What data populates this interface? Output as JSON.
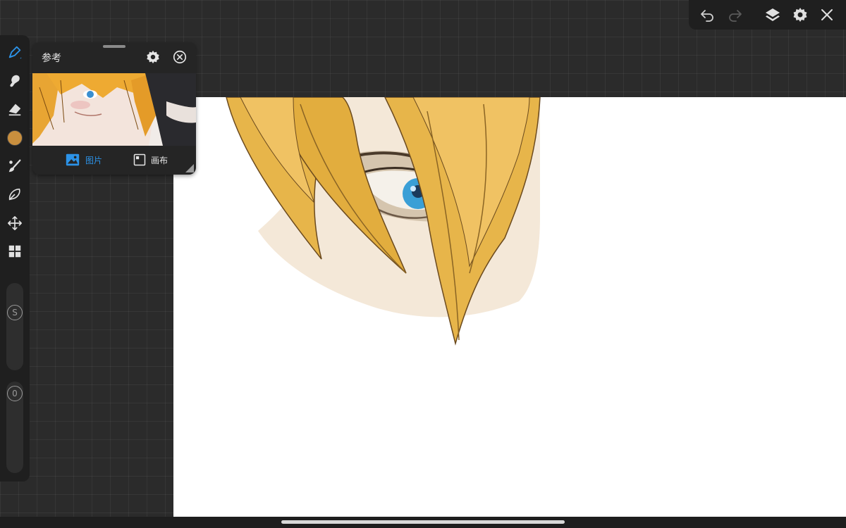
{
  "toolbar": {
    "buttons": [
      {
        "id": "undo",
        "icon": "undo-icon"
      },
      {
        "id": "redo",
        "icon": "redo-icon",
        "enabled": false
      },
      {
        "id": "layers",
        "icon": "layers-icon"
      },
      {
        "id": "settings",
        "icon": "gear-icon"
      },
      {
        "id": "close",
        "icon": "close-icon"
      }
    ]
  },
  "tools": {
    "items": [
      {
        "id": "pen",
        "icon": "pen-icon",
        "active": true
      },
      {
        "id": "smudge",
        "icon": "smudge-icon"
      },
      {
        "id": "eraser",
        "icon": "eraser-icon"
      },
      {
        "id": "color",
        "icon": "color-swatch",
        "color": "#c98f3e"
      },
      {
        "id": "brush-settings",
        "icon": "brush-icon"
      },
      {
        "id": "selection",
        "icon": "lasso-icon"
      },
      {
        "id": "transform",
        "icon": "move-icon"
      },
      {
        "id": "gallery",
        "icon": "grid-icon"
      }
    ],
    "size_slider_label": "S",
    "opacity_slider_label": "0"
  },
  "reference": {
    "title": "参考",
    "tabs": [
      {
        "label": "图片",
        "icon": "image-icon",
        "active": true
      },
      {
        "label": "画布",
        "icon": "canvas-icon",
        "active": false
      }
    ]
  },
  "colors": {
    "accent": "#2c93e8",
    "hair": "#e8b64a",
    "hair_line": "#6b4a1e",
    "skin": "#f4e8d8",
    "iris": "#3a9fd6",
    "background": "#2b2b2b",
    "panel": "#1f1f1f"
  }
}
